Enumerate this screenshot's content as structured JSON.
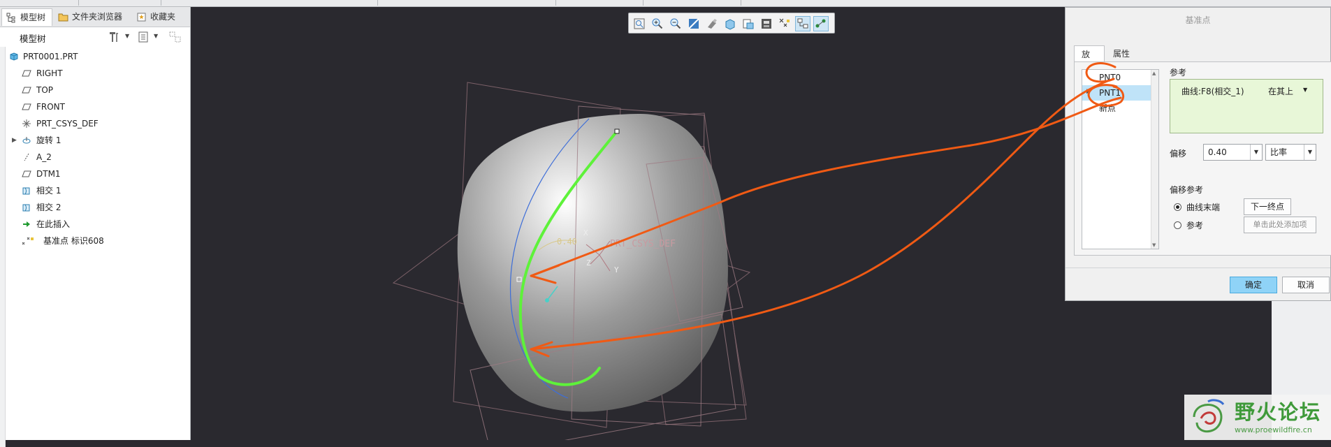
{
  "left_panel": {
    "tabs": [
      {
        "label": "模型树",
        "icon": "model-tree-icon"
      },
      {
        "label": "文件夹浏览器",
        "icon": "folder-browser-icon"
      },
      {
        "label": "收藏夹",
        "icon": "favorites-icon"
      }
    ],
    "tree_header": "模型树",
    "tree_items": [
      {
        "label": "PRT0001.PRT",
        "icon": "part-icon"
      },
      {
        "label": "RIGHT",
        "icon": "datum-plane-icon"
      },
      {
        "label": "TOP",
        "icon": "datum-plane-icon"
      },
      {
        "label": "FRONT",
        "icon": "datum-plane-icon"
      },
      {
        "label": "PRT_CSYS_DEF",
        "icon": "csys-icon"
      },
      {
        "label": "旋转 1",
        "icon": "revolve-icon",
        "expandable": true
      },
      {
        "label": "A_2",
        "icon": "datum-axis-icon"
      },
      {
        "label": "DTM1",
        "icon": "datum-plane-icon"
      },
      {
        "label": "相交 1",
        "icon": "intersect-icon"
      },
      {
        "label": "相交 2",
        "icon": "intersect-icon"
      },
      {
        "label": "在此插入",
        "icon": "insert-here-icon"
      },
      {
        "label": "基准点 标识608",
        "icon": "datum-point-icon"
      }
    ]
  },
  "view_toolbar": {
    "buttons": [
      "refit-icon",
      "zoom-in-icon",
      "zoom-out-icon",
      "repaint-icon",
      "display-style-icon",
      "saved-views-icon",
      "view-manager-icon",
      "section-icon",
      "datum-display-icon",
      "spin-center-icon",
      "annotation-display-icon"
    ],
    "active": [
      9,
      10
    ]
  },
  "viewport": {
    "annotations": {
      "offset_value": "0.40",
      "csys_label": "PRT_CSYS_DEF",
      "axis_x": "X",
      "axis_y": "Y",
      "axis_z": "Z"
    }
  },
  "dialog": {
    "title": "基准点",
    "tabs": [
      "放置",
      "属性"
    ],
    "points": [
      "PNT0",
      "PNT1",
      "新点"
    ],
    "selected_point": "PNT1",
    "reference_label": "参考",
    "reference_value": "曲线:F8(相交_1)",
    "reference_constraint": "在其上",
    "offset_label": "偏移",
    "offset_value": "0.40",
    "offset_type": "比率",
    "offset_ref_label": "偏移参考",
    "option_curve_end": "曲线末端",
    "next_endpoint_button": "下一终点",
    "option_reference": "参考",
    "add_ref_placeholder": "单击此处添加项",
    "ok_button": "确定",
    "cancel_button": "取消"
  },
  "watermark": {
    "text": "野火论坛",
    "url": "www.proewildfire.cn"
  },
  "colors": {
    "viewport_bg": "#2a292f",
    "annotation_stroke": "#f05a14",
    "curve_green": "#5ef23a",
    "selected_row": "#bfe3f8",
    "reference_box": "#e8f7d8",
    "ok_button": "#8fd3f7"
  }
}
